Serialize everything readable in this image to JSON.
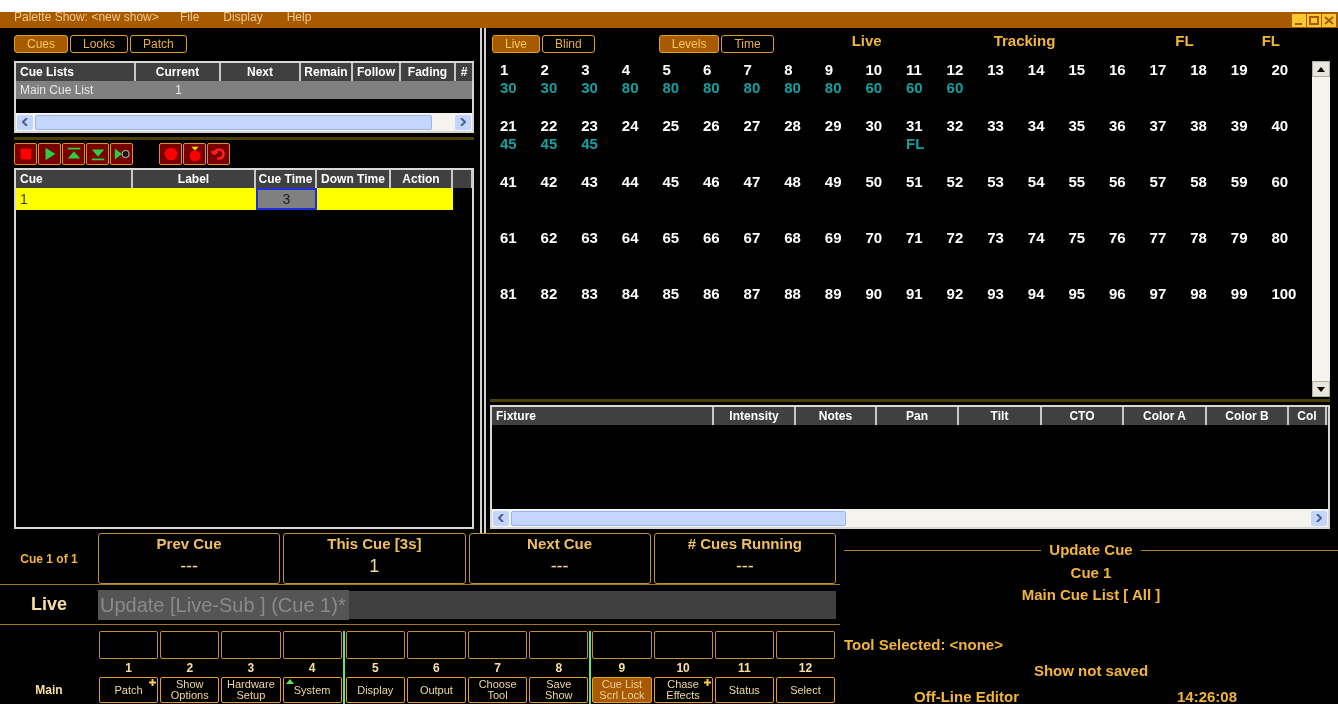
{
  "window": {
    "title": "Palette Show: <new show>",
    "menu": [
      "File",
      "Display",
      "Help"
    ]
  },
  "left_tabs": [
    {
      "label": "Cues",
      "selected": true
    },
    {
      "label": "Looks",
      "selected": false
    },
    {
      "label": "Patch",
      "selected": false
    }
  ],
  "cue_lists": {
    "columns": [
      "Cue Lists",
      "Current",
      "Next",
      "Remain",
      "Follow",
      "Fading",
      "#"
    ],
    "rows": [
      {
        "cells": [
          {
            "text": "Main Cue List"
          },
          {
            "text": "1"
          }
        ],
        "selected": true
      }
    ]
  },
  "cue_table": {
    "columns": [
      "Cue",
      "Label",
      "Cue Time",
      "Down Time",
      "Action"
    ],
    "rows": [
      {
        "selected": true,
        "cells": [
          {
            "text": "1",
            "focused": false
          },
          {
            "focused": false
          },
          {
            "text": "3",
            "focused": true
          },
          {
            "focused": false
          },
          {
            "focused": false
          }
        ]
      }
    ]
  },
  "mode_tabs": [
    {
      "label": "Live",
      "selected": true
    },
    {
      "label": "Blind",
      "selected": false
    }
  ],
  "view_tabs": [
    {
      "label": "Levels",
      "selected": true
    },
    {
      "label": "Time",
      "selected": false
    }
  ],
  "header_labels": [
    "Live",
    "Tracking",
    "FL",
    "FL"
  ],
  "channels": [
    {
      "number": "1",
      "value": "30"
    },
    {
      "number": "2",
      "value": "30"
    },
    {
      "number": "3",
      "value": "30"
    },
    {
      "number": "4",
      "value": "80"
    },
    {
      "number": "5",
      "value": "80"
    },
    {
      "number": "6",
      "value": "80"
    },
    {
      "number": "7",
      "value": "80"
    },
    {
      "number": "8",
      "value": "80"
    },
    {
      "number": "9",
      "value": "80"
    },
    {
      "number": "10",
      "value": "60"
    },
    {
      "number": "11",
      "value": "60"
    },
    {
      "number": "12",
      "value": "60"
    },
    {
      "number": "13"
    },
    {
      "number": "14"
    },
    {
      "number": "15"
    },
    {
      "number": "16"
    },
    {
      "number": "17"
    },
    {
      "number": "18"
    },
    {
      "number": "19"
    },
    {
      "number": "20"
    },
    {
      "number": "21",
      "value": "45"
    },
    {
      "number": "22",
      "value": "45"
    },
    {
      "number": "23",
      "value": "45"
    },
    {
      "number": "24"
    },
    {
      "number": "25"
    },
    {
      "number": "26"
    },
    {
      "number": "27"
    },
    {
      "number": "28"
    },
    {
      "number": "29"
    },
    {
      "number": "30"
    },
    {
      "number": "31",
      "value": "FL"
    },
    {
      "number": "32"
    },
    {
      "number": "33"
    },
    {
      "number": "34"
    },
    {
      "number": "35"
    },
    {
      "number": "36"
    },
    {
      "number": "37"
    },
    {
      "number": "38"
    },
    {
      "number": "39"
    },
    {
      "number": "40"
    },
    {
      "number": "41"
    },
    {
      "number": "42"
    },
    {
      "number": "43"
    },
    {
      "number": "44"
    },
    {
      "number": "45"
    },
    {
      "number": "46"
    },
    {
      "number": "47"
    },
    {
      "number": "48"
    },
    {
      "number": "49"
    },
    {
      "number": "50"
    },
    {
      "number": "51"
    },
    {
      "number": "52"
    },
    {
      "number": "53"
    },
    {
      "number": "54"
    },
    {
      "number": "55"
    },
    {
      "number": "56"
    },
    {
      "number": "57"
    },
    {
      "number": "58"
    },
    {
      "number": "59"
    },
    {
      "number": "60"
    },
    {
      "number": "61"
    },
    {
      "number": "62"
    },
    {
      "number": "63"
    },
    {
      "number": "64"
    },
    {
      "number": "65"
    },
    {
      "number": "66"
    },
    {
      "number": "67"
    },
    {
      "number": "68"
    },
    {
      "number": "69"
    },
    {
      "number": "70"
    },
    {
      "number": "71"
    },
    {
      "number": "72"
    },
    {
      "number": "73"
    },
    {
      "number": "74"
    },
    {
      "number": "75"
    },
    {
      "number": "76"
    },
    {
      "number": "77"
    },
    {
      "number": "78"
    },
    {
      "number": "79"
    },
    {
      "number": "80"
    },
    {
      "number": "81"
    },
    {
      "number": "82"
    },
    {
      "number": "83"
    },
    {
      "number": "84"
    },
    {
      "number": "85"
    },
    {
      "number": "86"
    },
    {
      "number": "87"
    },
    {
      "number": "88"
    },
    {
      "number": "89"
    },
    {
      "number": "90"
    },
    {
      "number": "91"
    },
    {
      "number": "92"
    },
    {
      "number": "93"
    },
    {
      "number": "94"
    },
    {
      "number": "95"
    },
    {
      "number": "96"
    },
    {
      "number": "97"
    },
    {
      "number": "98"
    },
    {
      "number": "99"
    },
    {
      "number": "100"
    }
  ],
  "fixture_table": {
    "columns": [
      "Fixture",
      "Intensity",
      "Notes",
      "Pan",
      "Tilt",
      "CTO",
      "Color A",
      "Color B",
      "Col"
    ]
  },
  "summary": {
    "position": "Cue 1 of 1",
    "boxes": [
      {
        "title": "Prev Cue",
        "value": "---"
      },
      {
        "title": "This Cue [3s]",
        "value": "1"
      },
      {
        "title": "Next Cue",
        "value": "---"
      },
      {
        "title": "# Cues Running",
        "value": "---"
      }
    ]
  },
  "command": {
    "mode": "Live",
    "text": "Update [Live-Sub ] (Cue 1)*"
  },
  "softkeys": {
    "bank": "Main",
    "groups": [
      [
        {
          "number": "1",
          "label": "Patch",
          "plus": true,
          "arrow": false,
          "selected": false
        },
        {
          "number": "2",
          "label": "Show Options",
          "plus": false,
          "arrow": false,
          "selected": false
        },
        {
          "number": "3",
          "label": "Hardware Setup",
          "plus": false,
          "arrow": false,
          "selected": false
        },
        {
          "number": "4",
          "label": "System",
          "plus": false,
          "arrow": true,
          "selected": false
        }
      ],
      [
        {
          "number": "5",
          "label": "Display",
          "plus": false,
          "arrow": false,
          "selected": false
        },
        {
          "number": "6",
          "label": "Output",
          "plus": false,
          "arrow": false,
          "selected": false
        },
        {
          "number": "7",
          "label": "Choose Tool",
          "plus": false,
          "arrow": false,
          "selected": false
        },
        {
          "number": "8",
          "label": "Save Show",
          "plus": false,
          "arrow": false,
          "selected": false
        }
      ],
      [
        {
          "number": "9",
          "label": "Cue List Scrl Lock",
          "plus": false,
          "arrow": false,
          "selected": true
        },
        {
          "number": "10",
          "label": "Chase Effects",
          "plus": true,
          "arrow": false,
          "selected": false
        },
        {
          "number": "11",
          "label": "Status",
          "plus": false,
          "arrow": false,
          "selected": false
        },
        {
          "number": "12",
          "label": "Select",
          "plus": false,
          "arrow": false,
          "selected": false
        }
      ]
    ]
  },
  "info": {
    "title": "Update Cue",
    "lines": [
      "Cue 1",
      "Main Cue List [ All ]"
    ],
    "tool": "Tool Selected: <none>",
    "status": "Show not saved",
    "mode": "Off-Line Editor",
    "clock": "14:26:08"
  }
}
